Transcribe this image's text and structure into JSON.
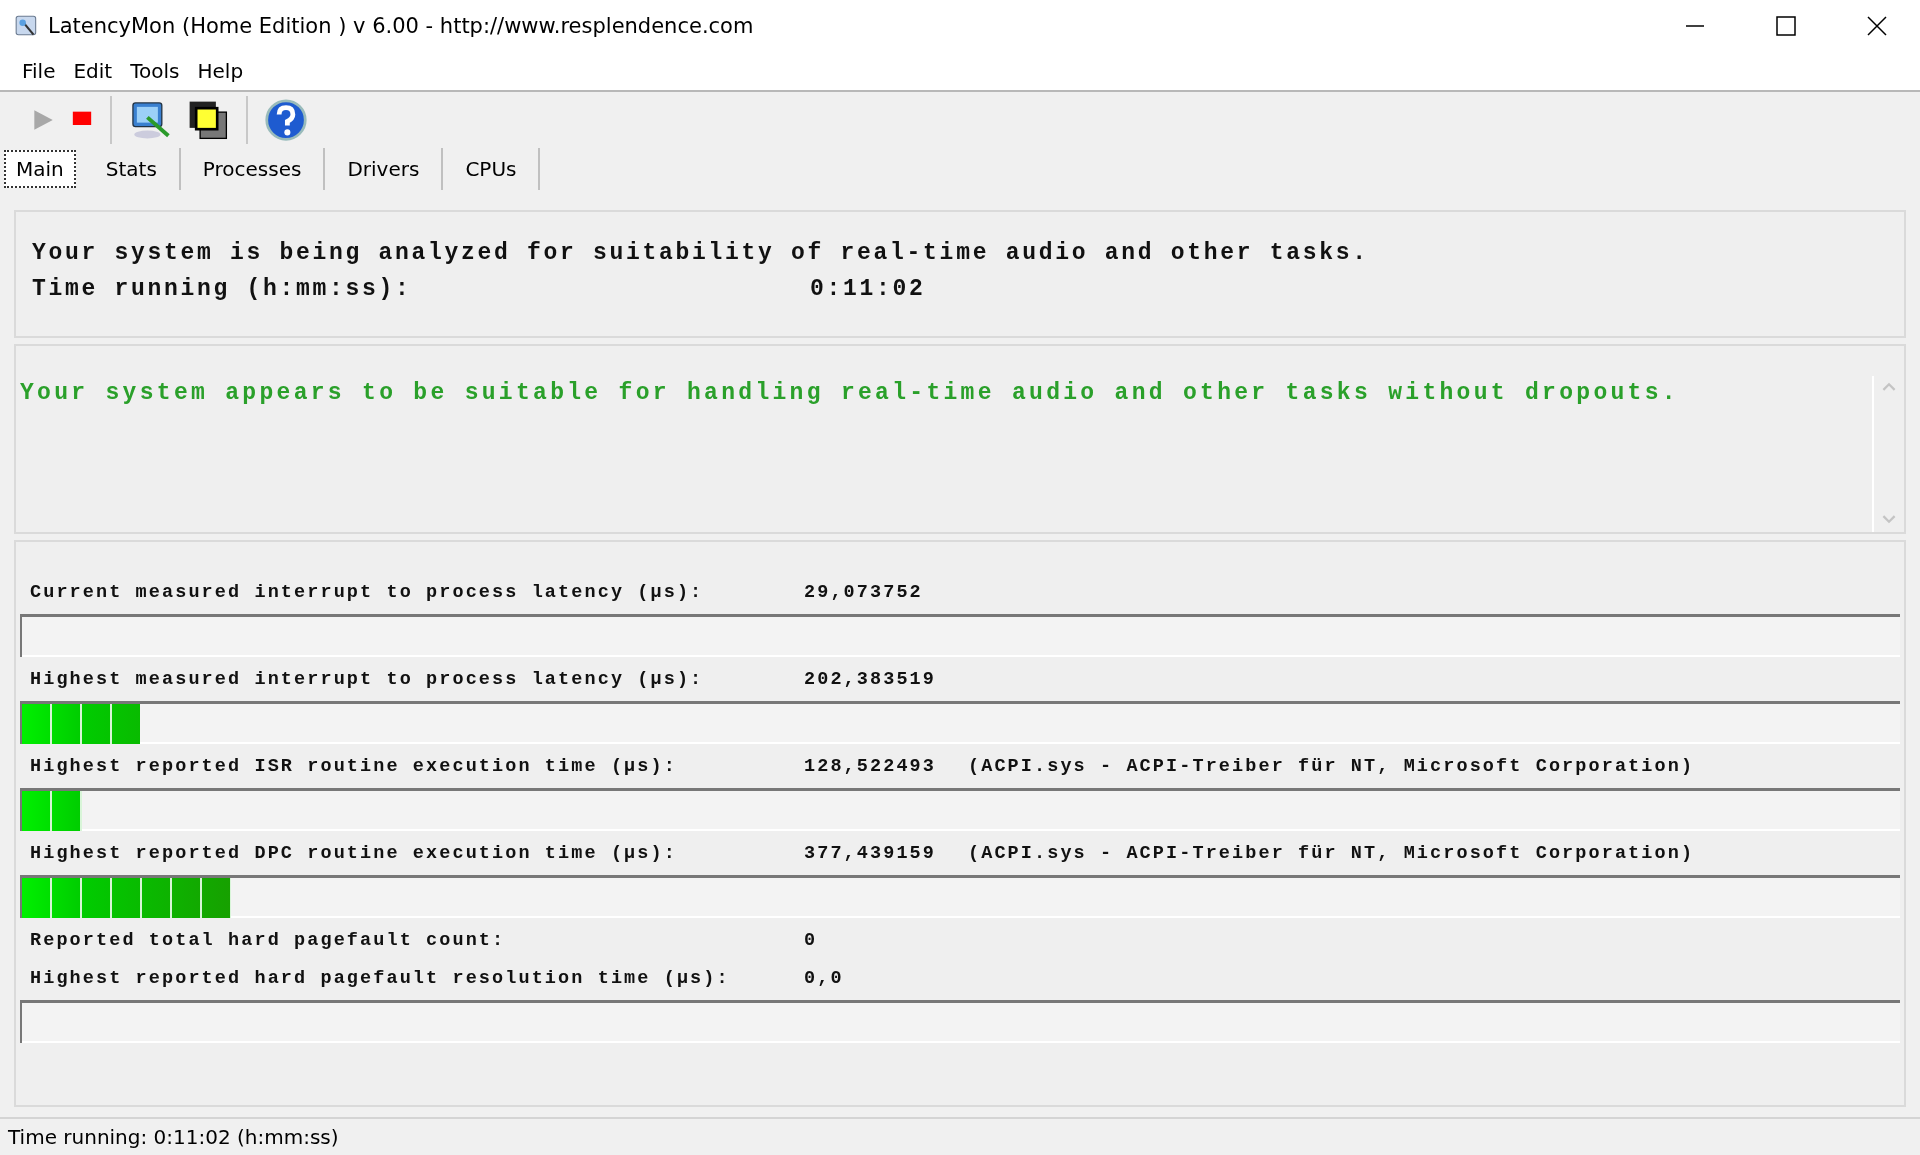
{
  "window": {
    "title": "LatencyMon  (Home Edition )  v 6.00 - http://www.resplendence.com"
  },
  "menu": [
    {
      "label": "File"
    },
    {
      "label": "Edit"
    },
    {
      "label": "Tools"
    },
    {
      "label": "Help"
    }
  ],
  "toolbar": {
    "start_disabled": true
  },
  "tabs": [
    {
      "label": "Main",
      "selected": true
    },
    {
      "label": "Stats",
      "selected": false
    },
    {
      "label": "Processes",
      "selected": false
    },
    {
      "label": "Drivers",
      "selected": false
    },
    {
      "label": "CPUs",
      "selected": false
    }
  ],
  "analysis": {
    "message": "Your system is being analyzed for suitability of real-time audio and other tasks.",
    "time_label": "Time running (h:mm:ss):",
    "time_value": "0:11:02"
  },
  "verdict": {
    "message": "Your system appears to be suitable for handling real-time audio and other tasks without dropouts."
  },
  "metrics": [
    {
      "kind": "meter",
      "label": "Current measured interrupt to process latency (µs):",
      "value": "29,073752",
      "level": 0
    },
    {
      "kind": "meter",
      "label": "Highest measured interrupt to process latency (µs):",
      "value": "202,383519",
      "level": 0.063
    },
    {
      "kind": "meter",
      "label": "Highest reported ISR routine execution time (µs):",
      "value": "128,522493",
      "detail": "(ACPI.sys - ACPI-Treiber für NT, Microsoft Corporation)",
      "level": 0.032
    },
    {
      "kind": "meter",
      "label": "Highest reported DPC routine execution time (µs):",
      "value": "377,439159",
      "detail": "(ACPI.sys - ACPI-Treiber für NT, Microsoft Corporation)",
      "level": 0.111
    },
    {
      "kind": "text",
      "label": "Reported total hard pagefault count:",
      "value": "0"
    },
    {
      "kind": "meter",
      "label": "Highest reported hard pagefault resolution time (µs):",
      "value": "0,0",
      "level": 0
    }
  ],
  "status_bar": {
    "text": "Time running: 0:11:02  (h:mm:ss)"
  }
}
